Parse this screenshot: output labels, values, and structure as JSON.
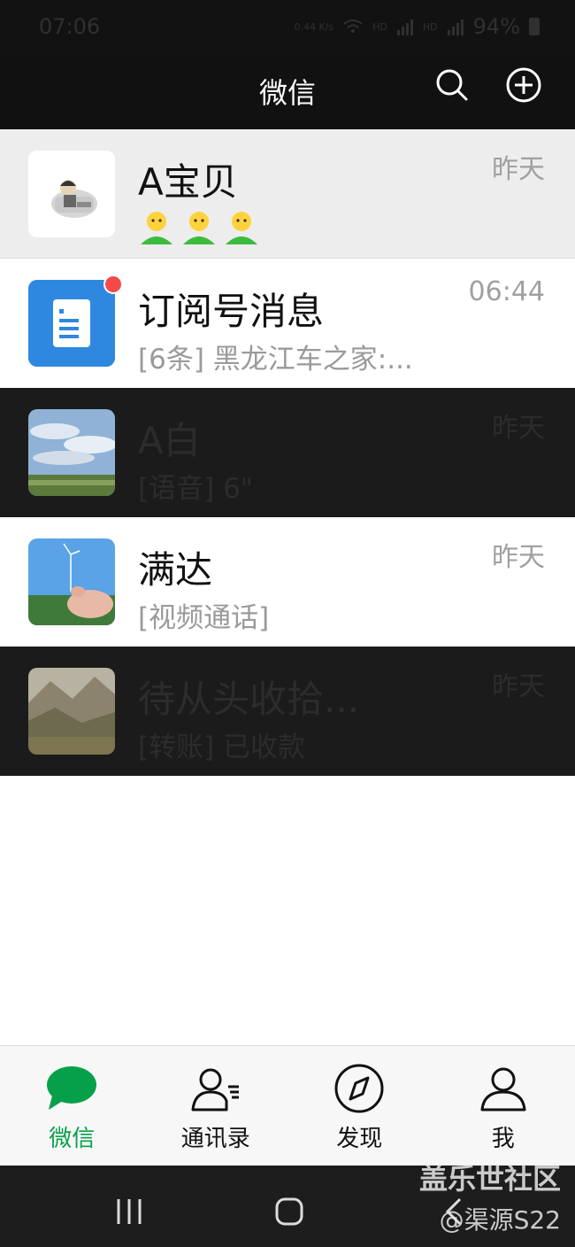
{
  "status_bar": {
    "time": "07:06",
    "net_speed": "0.44 K/s",
    "hd1": "HD",
    "hd2": "HD",
    "battery": "94%"
  },
  "header": {
    "title": "微信"
  },
  "chats": [
    {
      "name": "A宝贝",
      "preview_emoji": "🙂🙂🙂",
      "time": "昨天"
    },
    {
      "name": "订阅号消息",
      "preview": "[6条] 黑龙江车之家:...",
      "time": "06:44"
    },
    {
      "name": "A白",
      "preview": "[语音] 6\"",
      "time": "昨天"
    },
    {
      "name": "满达",
      "preview": "[视频通话]",
      "time": "昨天"
    },
    {
      "name": "待从头收拾...",
      "preview": "[转账] 已收款",
      "time": "昨天"
    }
  ],
  "tabs": [
    {
      "label": "微信",
      "icon": "chat-bubble-icon",
      "active": true
    },
    {
      "label": "通讯录",
      "icon": "contacts-icon",
      "active": false
    },
    {
      "label": "发现",
      "icon": "compass-icon",
      "active": false
    },
    {
      "label": "我",
      "icon": "profile-icon",
      "active": false
    }
  ],
  "watermark": {
    "line1": "盖乐世社区",
    "line2": "@渠源S22"
  },
  "colors": {
    "accent": "#07a04a",
    "unread": "#f24a48",
    "header_bg": "#111111"
  }
}
